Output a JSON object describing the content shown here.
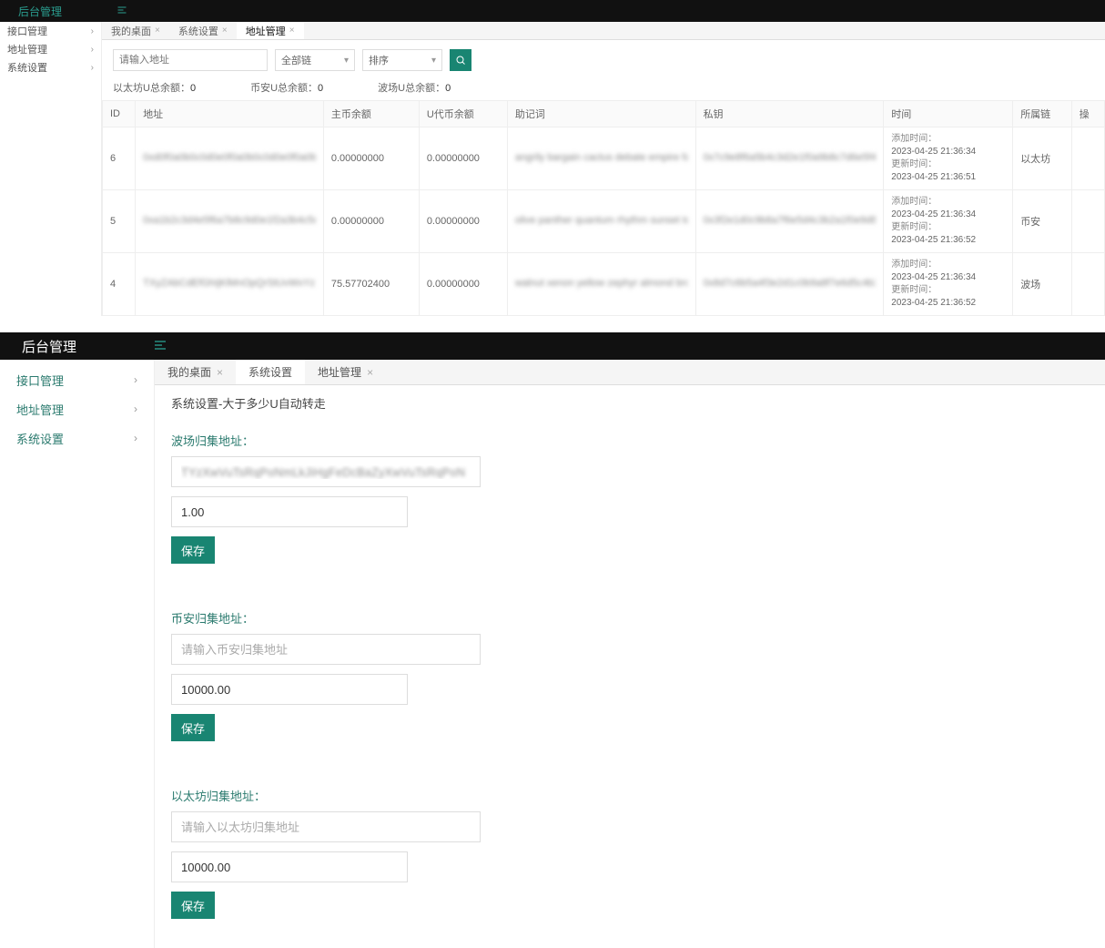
{
  "panel1": {
    "brand": "后台管理",
    "sidebar": [
      {
        "label": "接口管理"
      },
      {
        "label": "地址管理"
      },
      {
        "label": "系统设置"
      }
    ],
    "tabs": [
      {
        "label": "我的桌面",
        "active": false
      },
      {
        "label": "系统设置",
        "active": false
      },
      {
        "label": "地址管理",
        "active": true
      }
    ],
    "filters": {
      "addr_ph": "请输入地址",
      "chain": "全部链",
      "sort": "排序"
    },
    "stats": {
      "eth_label": "以太坊U总余额：",
      "eth_val": "0",
      "bian_label": "币安U总余额：",
      "bian_val": "0",
      "bosch_label": "波场U总余额：",
      "bosch_val": "0"
    },
    "columns": [
      "ID",
      "地址",
      "主币余额",
      "U代币余额",
      "助记词",
      "私钥",
      "时间",
      "所属链",
      "操"
    ],
    "time_labels": {
      "add": "添加时间：",
      "upd": "更新时间："
    },
    "rows": [
      {
        "id": "6",
        "addr": "0xd0f0a0b0c0d0e0f0a0b0c0d0e0f0a0b0c0d0e047c",
        "main": "0.00000000",
        "u": "0.00000000",
        "mne": "angrily bargain cactus debate empire fabric garlic bot over",
        "pk": "0x7c9e8f6a5b4c3d2e1f0a9b8c7d6e5f4a3b2c1d0e",
        "t1": "2023-04-25 21:36:34",
        "t2": "2023-04-25 21:36:51",
        "chain": "以太坊"
      },
      {
        "id": "5",
        "addr": "0xa1b2c3d4e5f6a7b8c9d0e1f2a3b4c5d6e7f8a9b0",
        "main": "0.00000000",
        "u": "0.00000000",
        "mne": "olive panther quantum rhythm sunset tornado umbrella violet",
        "pk": "0x3f2e1d0c9b8a7f6e5d4c3b2a1f0e9d8c7b6a5f4e",
        "t1": "2023-04-25 21:36:34",
        "t2": "2023-04-25 21:36:52",
        "chain": "币安"
      },
      {
        "id": "4",
        "addr": "TXyZAbCdEfGhIjKlMnOpQrStUvWxYz1234567890",
        "main": "75.57702400",
        "u": "0.00000000",
        "mne": "walnut xenon yellow zephyr almond bronze copper d over",
        "pk": "0x8d7c6b5a4f3e2d1c0b9a8f7e6d5c4b3a2f1e0d9c",
        "t1": "2023-04-25 21:36:34",
        "t2": "2023-04-25 21:36:52",
        "chain": "波场"
      }
    ]
  },
  "panel2": {
    "brand": "后台管理",
    "sidebar": [
      {
        "label": "接口管理"
      },
      {
        "label": "地址管理"
      },
      {
        "label": "系统设置"
      }
    ],
    "tabs": [
      {
        "label": "我的桌面",
        "active": false
      },
      {
        "label": "系统设置",
        "active": true
      },
      {
        "label": "地址管理",
        "active": false
      }
    ],
    "page_title": "系统设置-大于多少U自动转走",
    "sections": [
      {
        "title": "波场归集地址：",
        "addr_val": "TYzXwVuTsRqPoNmLkJiHgFeDcBaZyXwVuTsRqPoN",
        "addr_ph": "",
        "num_val": "1.00",
        "save": "保存",
        "blurred": true
      },
      {
        "title": "币安归集地址：",
        "addr_val": "",
        "addr_ph": "请输入币安归集地址",
        "num_val": "10000.00",
        "save": "保存",
        "blurred": false
      },
      {
        "title": "以太坊归集地址：",
        "addr_val": "",
        "addr_ph": "请输入以太坊归集地址",
        "num_val": "10000.00",
        "save": "保存",
        "blurred": false
      }
    ]
  }
}
